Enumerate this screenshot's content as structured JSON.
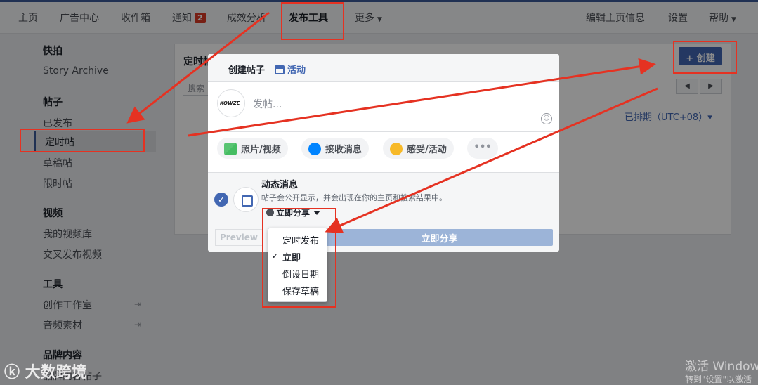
{
  "nav": {
    "home": "主页",
    "ads": "广告中心",
    "inbox": "收件箱",
    "notifications": "通知",
    "notifications_badge": "2",
    "insights": "成效分析",
    "publishing_tools": "发布工具",
    "more": "更多",
    "edit_page_info": "编辑主页信息",
    "settings": "设置",
    "help": "帮助"
  },
  "sidebar": {
    "sections": [
      {
        "heading": "快拍",
        "items": [
          "Story Archive"
        ]
      },
      {
        "heading": "帖子",
        "items": [
          "已发布",
          "定时帖",
          "草稿帖",
          "限时帖"
        ]
      },
      {
        "heading": "视频",
        "items": [
          "我的视频库",
          "交叉发布视频"
        ]
      },
      {
        "heading": "工具",
        "items": [
          "创作工作室",
          "音频素材"
        ]
      },
      {
        "heading": "品牌内容",
        "items": [
          "品牌内容帖子"
        ]
      }
    ]
  },
  "panel": {
    "title": "定时帖",
    "create_label": "+ 创建",
    "search_placeholder": "搜索",
    "prev": "◀",
    "next": "▶",
    "scheduled_column": "已排期（UTC+08）▾"
  },
  "dialog": {
    "tab_create_post": "创建帖子",
    "tab_event": "活动",
    "avatar_logo": "KOWZE",
    "placeholder": "发帖...",
    "actions": {
      "photo_video": "照片/视频",
      "get_messages": "接收消息",
      "feeling_activity": "感受/活动",
      "more": "•••"
    },
    "news_feed_title": "动态消息",
    "news_feed_desc": "帖子会公开显示，并会出现在你的主页和搜索结果中。",
    "share_now_select": "立即分享",
    "preview_label": "Preview",
    "share_now_button": "立即分享"
  },
  "dropdown": {
    "items": [
      "定时发布",
      "立即",
      "倒设日期",
      "保存草稿"
    ],
    "selected_index": 1,
    "check_mark": "✓"
  },
  "watermarks": {
    "logo": "大数跨境",
    "windows_activate": "激活 Windows",
    "windows_sub": "转到\"设置\"以激活"
  },
  "colors": {
    "accent": "#4267b2",
    "annotation_red": "#e53222"
  }
}
